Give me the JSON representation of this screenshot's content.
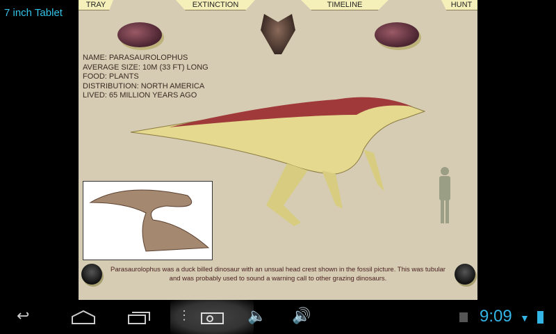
{
  "window_title": "7 inch Tablet",
  "tabs": [
    "TRAY",
    "EXTINCTION",
    "TIMELINE",
    "HUNT"
  ],
  "info": {
    "name": "NAME: PARASAUROLOPHUS",
    "size": "AVERAGE SIZE: 10M (33 FT) LONG",
    "food": "FOOD: PLANTS",
    "distribution": "DISTRIBUTION: NORTH AMERICA",
    "lived": "LIVED: 65 MILLION YEARS AGO"
  },
  "description": "Parasaurolophus was a duck billed dinosaur with an unsual head crest shown in the fossil picture. This was tubular and was probably used to sound a warning call to other grazing dinosaurs.",
  "status": {
    "time": "9:09"
  }
}
